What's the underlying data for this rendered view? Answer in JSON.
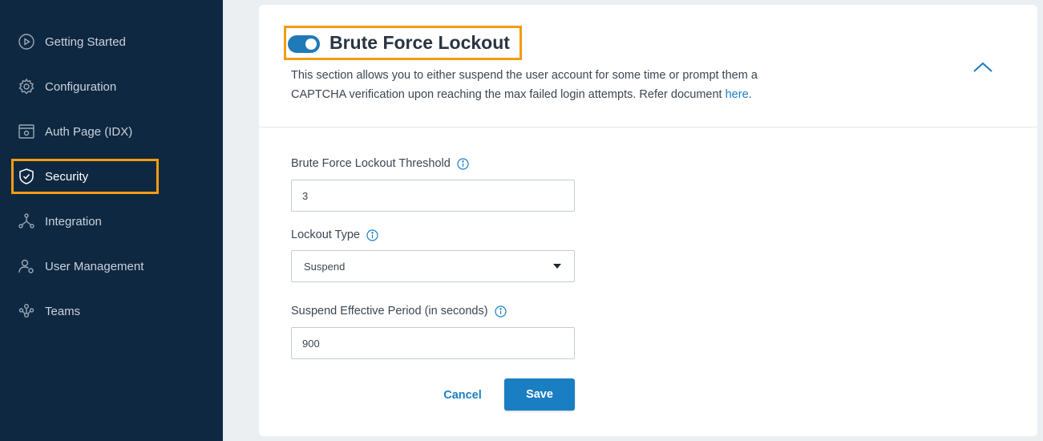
{
  "sidebar": {
    "items": [
      {
        "label": "Getting Started",
        "icon": "play-circle-icon"
      },
      {
        "label": "Configuration",
        "icon": "gear-icon"
      },
      {
        "label": "Auth Page (IDX)",
        "icon": "auth-page-icon"
      },
      {
        "label": "Security",
        "icon": "shield-icon",
        "active": true
      },
      {
        "label": "Integration",
        "icon": "integration-icon"
      },
      {
        "label": "User Management",
        "icon": "user-gear-icon"
      },
      {
        "label": "Teams",
        "icon": "teams-icon"
      }
    ]
  },
  "section": {
    "title": "Brute Force Lockout",
    "enabled": true,
    "description_prefix": "This section allows you to either suspend the user account for some time or prompt them a CAPTCHA verification upon reaching the max failed login attempts. Refer document ",
    "description_link": "here",
    "description_suffix": "."
  },
  "form": {
    "threshold_label": "Brute Force Lockout Threshold",
    "threshold_value": "3",
    "lockout_type_label": "Lockout Type",
    "lockout_type_value": "Suspend",
    "period_label": "Suspend Effective Period (in seconds)",
    "period_value": "900"
  },
  "actions": {
    "cancel_label": "Cancel",
    "save_label": "Save"
  },
  "colors": {
    "sidebar_bg": "#0f2841",
    "accent": "#1a7ec3",
    "highlight": "#f39c12"
  }
}
